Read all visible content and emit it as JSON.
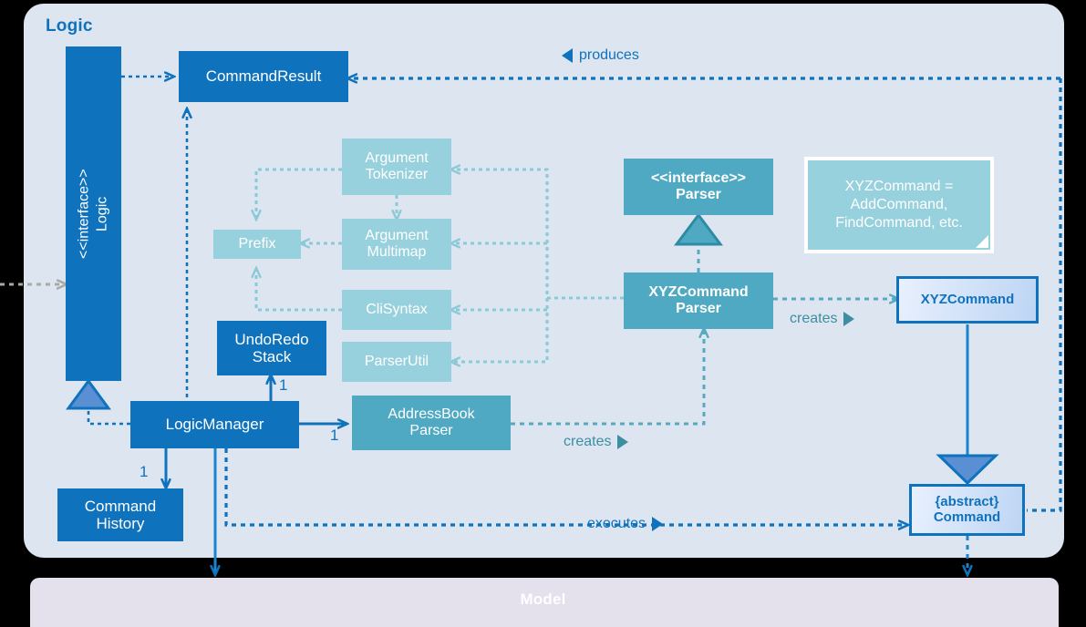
{
  "panels": {
    "logic": {
      "title": "Logic"
    },
    "model": {
      "title": "Model"
    }
  },
  "classes": {
    "logic_interface": {
      "stereotype": "<<interface>>",
      "name": "Logic",
      "label": "<<interface>>\nLogic"
    },
    "command_result": {
      "label": "CommandResult"
    },
    "argument_tokenizer": {
      "label": "Argument\nTokenizer"
    },
    "argument_multimap": {
      "label": "Argument\nMultimap"
    },
    "prefix": {
      "label": "Prefix"
    },
    "cli_syntax": {
      "label": "CliSyntax"
    },
    "parser_util": {
      "label": "ParserUtil"
    },
    "undo_redo_stack": {
      "label": "UndoRedo\nStack"
    },
    "logic_manager": {
      "label": "LogicManager"
    },
    "command_history": {
      "label": "Command\nHistory"
    },
    "address_book_parser": {
      "label": "AddressBook\nParser"
    },
    "parser_interface": {
      "stereotype": "<<interface>>",
      "name": "Parser",
      "label": "<<interface>>\nParser"
    },
    "xyz_command_parser": {
      "label": "XYZCommand\nParser"
    },
    "xyz_command": {
      "label": "XYZCommand"
    },
    "command_abstract": {
      "label": "{abstract}\nCommand"
    }
  },
  "note": {
    "text": "XYZCommand =\nAddCommand,\nFindCommand, etc."
  },
  "edge_labels": {
    "produces": "produces",
    "creates_parser": "creates",
    "creates_command": "creates",
    "executes": "executes"
  },
  "multiplicities": {
    "undo_redo_stack": "1",
    "address_book_parser": "1",
    "command_history": "1"
  },
  "colors": {
    "panel_logic_bg": "#dde6f0",
    "panel_model_bg": "#e4e0ec",
    "strong_blue": "#0f72bd",
    "teal": "#4fa9c2",
    "light_teal": "#97d1de",
    "label_teal": "#3c8ea3",
    "inherit_triangle": "#5b8fd4",
    "page_bg": "#000000"
  }
}
